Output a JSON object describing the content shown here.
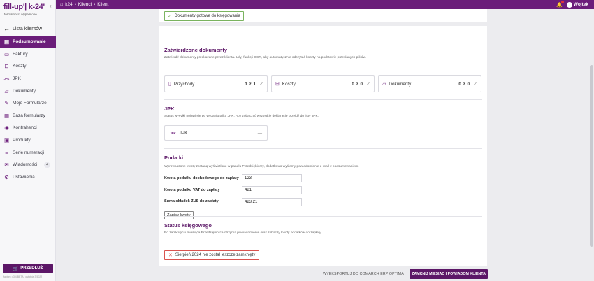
{
  "brand": {
    "logo": "fill-up'| k-24'",
    "tagline": "formalności wypełnione"
  },
  "sidebar": {
    "back_label": "Lista klientów",
    "items": [
      {
        "label": "Podsumowanie",
        "icon": "summary-icon",
        "active": true
      },
      {
        "label": "Faktury",
        "icon": "invoice-icon"
      },
      {
        "label": "Koszty",
        "icon": "costs-icon"
      },
      {
        "label": "JPK",
        "icon": "jpk-icon"
      },
      {
        "label": "Dokumenty",
        "icon": "documents-icon"
      },
      {
        "label": "Moje Formularze",
        "icon": "my-forms-icon"
      },
      {
        "label": "Baza formularzy",
        "icon": "forms-base-icon"
      },
      {
        "label": "Kontrahenci",
        "icon": "contractors-icon"
      },
      {
        "label": "Produkty",
        "icon": "products-icon"
      },
      {
        "label": "Serie numeracji",
        "icon": "numbering-icon"
      },
      {
        "label": "Wiadomości",
        "icon": "messages-icon",
        "badge": "4"
      },
      {
        "label": "Ustawienia",
        "icon": "settings-icon"
      }
    ],
    "extend_label": "PRZEDŁUŻ",
    "version": "fakturę • 3.4 BETA | ostatnia 3.5022"
  },
  "topbar": {
    "crumbs": [
      "k24",
      "Klienci",
      "Klient"
    ],
    "user_name": "Wojtek"
  },
  "ready": {
    "label": "Dokumenty gotowe do księgowania"
  },
  "approved": {
    "title": "Zatwierdzone dokumenty",
    "desc": "Zatwierdź dokumenty przekazane przez klienta. Użyj funkcji OCR, aby automatycznie odczytać koszty na podstawie przesłanych plików.",
    "tiles": [
      {
        "label": "Przychody",
        "count": "1 z 1"
      },
      {
        "label": "Koszty",
        "count": "0 z 0"
      },
      {
        "label": "Dokumenty",
        "count": "0 z 0"
      }
    ]
  },
  "jpk": {
    "title": "JPK",
    "desc": "Status wysyłki pojawi się po wydaniu pliku JPK. Aby zobaczyć wszystkie deklaracje przejdź do listy JPK.",
    "tile_label": "JPK",
    "tile_status": "—"
  },
  "taxes": {
    "title": "Podatki",
    "desc": "Wprowadzone kwoty zostaną wyświetlone w panelu Przedsiębiorcy, dodatkowo wyślemy powiadomienie e-mail z podsumowaniem.",
    "rows": [
      {
        "label": "Kwota podatku dochodowego do zapłaty",
        "value": "123"
      },
      {
        "label": "Kwota podatku VAT do zapłaty",
        "value": "421"
      },
      {
        "label": "Suma składek ZUS do zapłaty",
        "value": "423,21"
      }
    ],
    "save_label": "Zapisz kwoty"
  },
  "status": {
    "title": "Status księgowego",
    "desc": "Po zamknięciu miesiąca Przedsiębiorca otrzyma powiadomienie oraz zobaczy kwoty podatków do zapłaty.",
    "message": "Sierpień 2024 nie został jeszcze zamknięty"
  },
  "actions": {
    "export_label": "WYEKSPORTUJ DO COMARCH ERP OPTIMA",
    "close_label": "ZAMKNIJ MIESIĄC I POWIADOM KLIENTA"
  },
  "colors": {
    "brand": "#6b1d7a",
    "ok": "#7ab35f",
    "error": "#d9534f"
  }
}
